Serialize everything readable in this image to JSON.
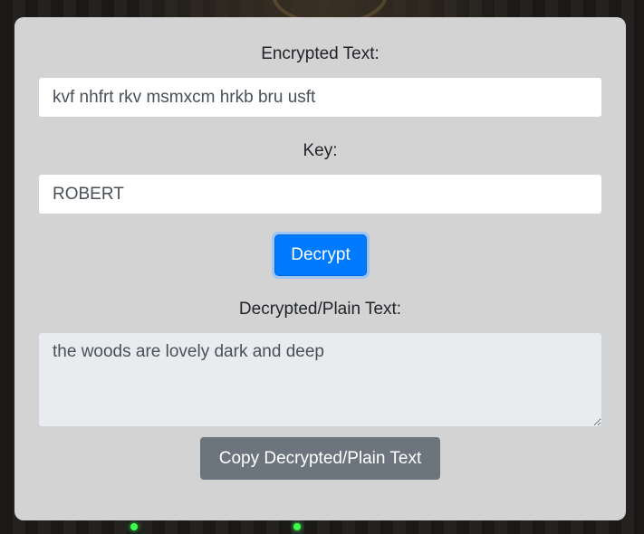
{
  "form": {
    "encrypted_label": "Encrypted Text:",
    "encrypted_value": "kvf nhfrt rkv msmxcm hrkb bru usft",
    "key_label": "Key:",
    "key_value": "ROBERT",
    "decrypt_button": "Decrypt",
    "plain_label": "Decrypted/Plain Text:",
    "plain_value": "the woods are lovely dark and deep",
    "copy_button": "Copy Decrypted/Plain Text"
  },
  "colors": {
    "card_background": "#d3d3d3",
    "primary": "#007bff",
    "secondary": "#6c757d",
    "readonly_background": "#e9ecef"
  }
}
